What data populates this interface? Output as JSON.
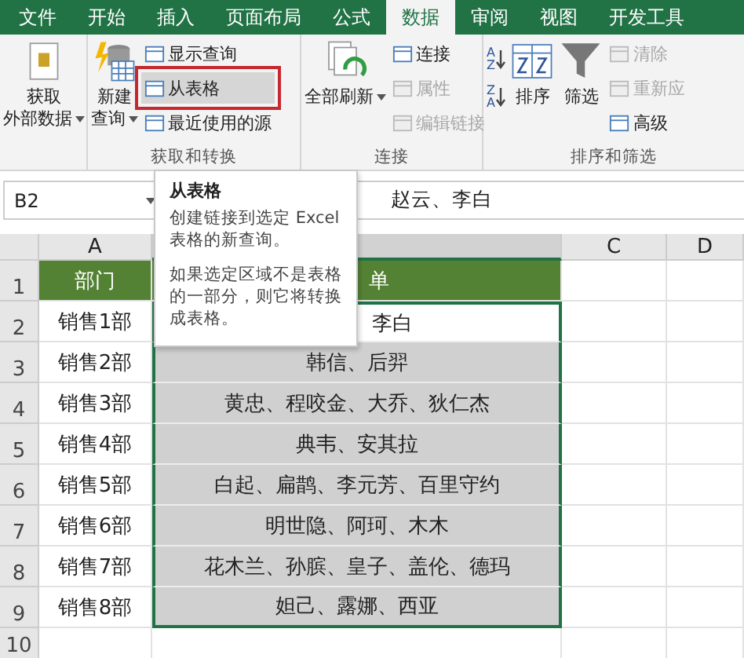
{
  "tabs": [
    {
      "label": "文件",
      "selected": false
    },
    {
      "label": "开始",
      "selected": false
    },
    {
      "label": "插入",
      "selected": false
    },
    {
      "label": "页面布局",
      "selected": false
    },
    {
      "label": "公式",
      "selected": false
    },
    {
      "label": "数据",
      "selected": true
    },
    {
      "label": "审阅",
      "selected": false
    },
    {
      "label": "视图",
      "selected": false
    },
    {
      "label": "开发工具",
      "selected": false
    }
  ],
  "ribbon": [
    {
      "items": [
        {
          "kind": "large",
          "lines": [
            "获取",
            "外部数据"
          ],
          "dropdown": true
        }
      ]
    },
    {
      "label": "获取和转换",
      "items": [
        {
          "kind": "large",
          "lines": [
            "新建",
            "查询"
          ],
          "dropdown": true
        },
        {
          "kind": "column",
          "items": [
            {
              "label": "显示查询",
              "disabled": false,
              "highlighted": false
            },
            {
              "label": "从表格",
              "disabled": false,
              "highlighted": true
            },
            {
              "label": "最近使用的源",
              "disabled": false,
              "highlighted": false
            }
          ]
        }
      ]
    },
    {
      "label": "连接",
      "items": [
        {
          "kind": "large",
          "lines": [
            "全部刷新"
          ],
          "dropdown": true
        },
        {
          "kind": "column",
          "items": [
            {
              "label": "连接",
              "disabled": false,
              "highlighted": false
            },
            {
              "label": "属性",
              "disabled": true,
              "highlighted": false
            },
            {
              "label": "编辑链接",
              "disabled": true,
              "highlighted": false
            }
          ]
        }
      ]
    },
    {
      "label": "排序和筛选",
      "items": [
        {
          "kind": "sort",
          "items": [
            {
              "top": "A",
              "bottom": "Z"
            },
            {
              "top": "Z",
              "bottom": "A"
            }
          ]
        },
        {
          "kind": "large",
          "lines": [
            "排序"
          ],
          "dropdown": false
        },
        {
          "kind": "large",
          "lines": [
            "筛选"
          ],
          "dropdown": false
        },
        {
          "kind": "column",
          "items": [
            {
              "label": "清除",
              "disabled": true,
              "highlighted": false
            },
            {
              "label": "重新应",
              "disabled": true,
              "highlighted": false
            },
            {
              "label": "高级",
              "disabled": false,
              "highlighted": false
            }
          ]
        }
      ]
    }
  ],
  "formula_bar": {
    "name_box": "B2",
    "value": "赵云、李白"
  },
  "tooltip": {
    "title": "从表格",
    "lines": [
      "创建链接到选定 Excel 表格的新查询。",
      "如果选定区域不是表格的一部分，则它将转换成表格。"
    ]
  },
  "columns": [
    {
      "label": "A",
      "selected": false
    },
    {
      "selected": true
    },
    {
      "label": "C",
      "selected": false
    },
    {
      "label": "D",
      "selected": false
    }
  ],
  "rows": [
    {
      "number": "1",
      "cells": [
        "部门",
        "单"
      ],
      "header": true,
      "selected": false
    },
    {
      "number": "2",
      "cells": [
        "销售1部",
        "李白"
      ],
      "header": false,
      "selected": true
    },
    {
      "number": "3",
      "cells": [
        "销售2部",
        "韩信、后羿"
      ],
      "header": false,
      "selected": true
    },
    {
      "number": "4",
      "cells": [
        "销售3部",
        "黄忠、程咬金、大乔、狄仁杰"
      ],
      "header": false,
      "selected": true
    },
    {
      "number": "5",
      "cells": [
        "销售4部",
        "典韦、安其拉"
      ],
      "header": false,
      "selected": true
    },
    {
      "number": "6",
      "cells": [
        "销售5部",
        "白起、扁鹊、李元芳、百里守约"
      ],
      "header": false,
      "selected": true
    },
    {
      "number": "7",
      "cells": [
        "销售6部",
        "明世隐、阿珂、木木"
      ],
      "header": false,
      "selected": true
    },
    {
      "number": "8",
      "cells": [
        "销售7部",
        "花木兰、孙膑、皇子、盖伦、德玛"
      ],
      "header": false,
      "selected": true
    },
    {
      "number": "9",
      "cells": [
        "销售8部",
        "妲己、露娜、西亚"
      ],
      "header": false,
      "selected": true
    },
    {
      "number": "10",
      "cells": [],
      "header": false,
      "selected": false
    }
  ]
}
